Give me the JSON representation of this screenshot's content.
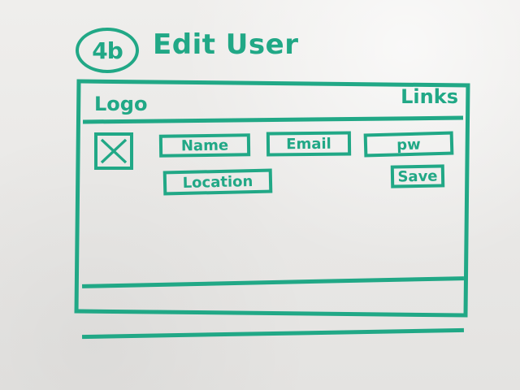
{
  "title": {
    "badge": "4b",
    "text": "Edit User"
  },
  "header": {
    "logo": "Logo",
    "links": "Links"
  },
  "form": {
    "avatar_icon": "image-placeholder-icon",
    "name_label": "Name",
    "email_label": "Email",
    "password_label": "pw",
    "location_label": "Location",
    "save_label": "Save"
  },
  "colors": {
    "ink": "#21a886",
    "board": "#e9e8e6"
  }
}
